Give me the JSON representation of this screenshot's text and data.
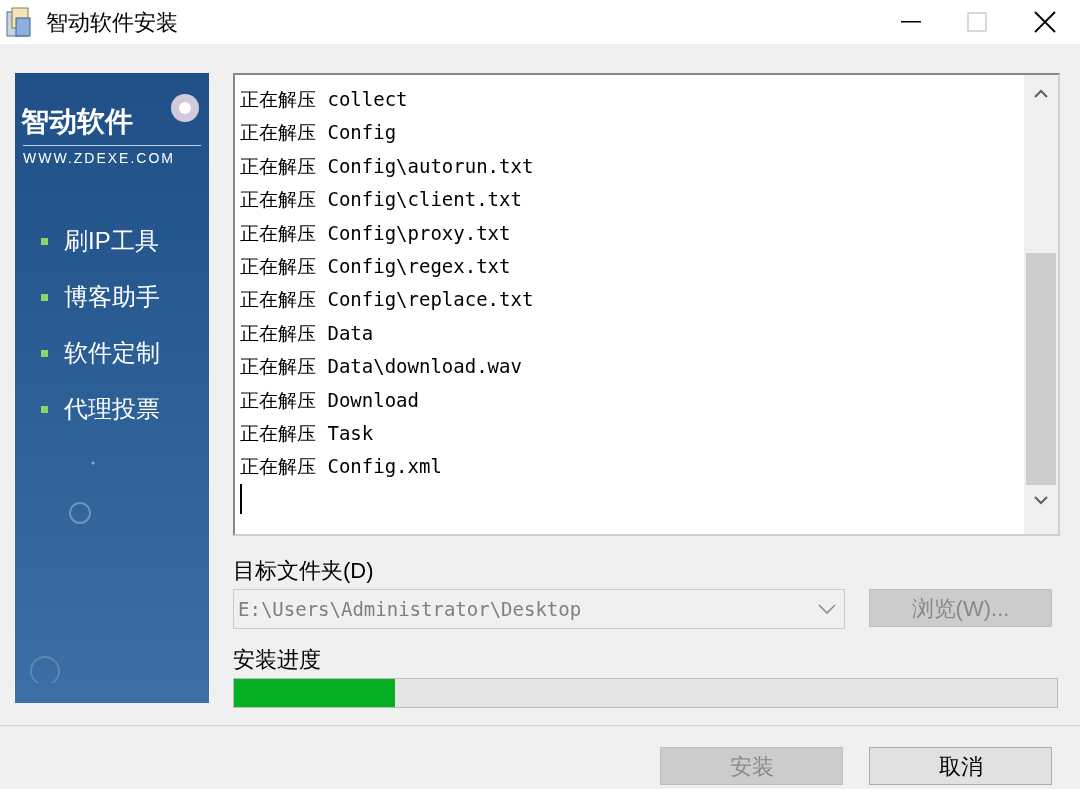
{
  "window": {
    "title": "智动软件安装",
    "maximize_disabled": true
  },
  "sidebar": {
    "logo": "智动软件",
    "url": "WWW.ZDEXE.COM",
    "items": [
      "刷IP工具",
      "博客助手",
      "软件定制",
      "代理投票"
    ]
  },
  "log": {
    "lines": [
      "正在解压 collect",
      "正在解压 Config",
      "正在解压 Config\\autorun.txt",
      "正在解压 Config\\client.txt",
      "正在解压 Config\\proxy.txt",
      "正在解压 Config\\regex.txt",
      "正在解压 Config\\replace.txt",
      "正在解压 Data",
      "正在解压 Data\\download.wav",
      "正在解压 Download",
      "正在解压 Task",
      "正在解压 Config.xml"
    ]
  },
  "folder": {
    "label": "目标文件夹(D)",
    "value": "E:\\Users\\Administrator\\Desktop",
    "disabled": true
  },
  "browse_button": {
    "label": "浏览(W)...",
    "disabled": true
  },
  "progress": {
    "label": "安装进度",
    "level": 0.196
  },
  "buttons": [
    {
      "label": "安装",
      "disabled": true
    },
    {
      "label": "取消",
      "disabled": false
    }
  ]
}
